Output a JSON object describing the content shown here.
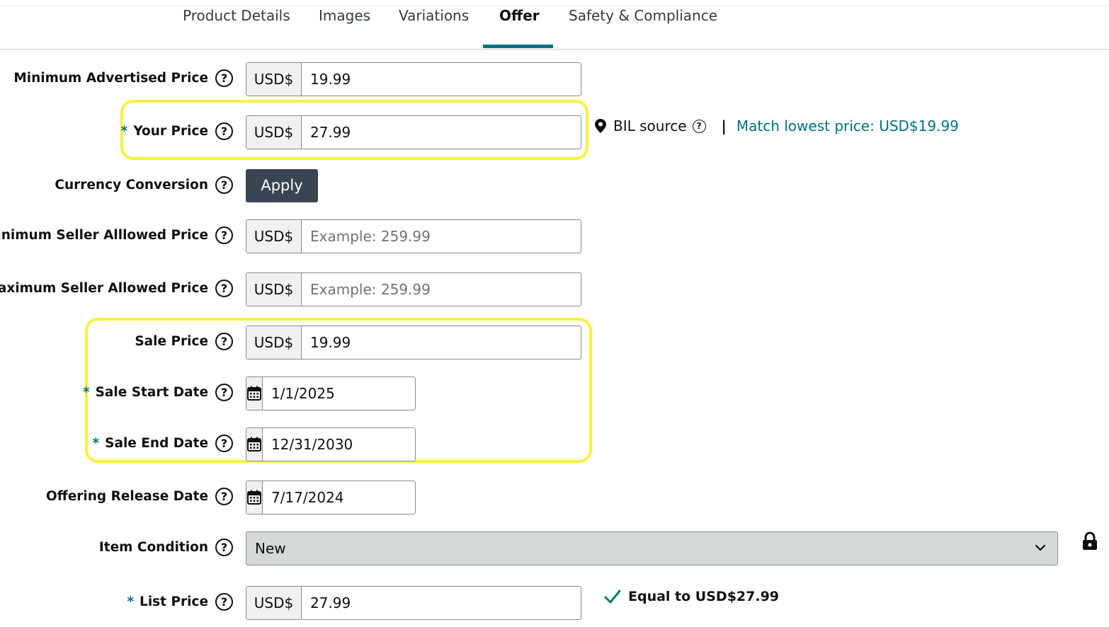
{
  "tabs": [
    {
      "label": "Product Details",
      "active": false
    },
    {
      "label": "Images",
      "active": false
    },
    {
      "label": "Variations",
      "active": false
    },
    {
      "label": "Offer",
      "active": true
    },
    {
      "label": "Safety & Compliance",
      "active": false
    }
  ],
  "currency_prefix": "USD$",
  "help_glyph": "?",
  "required_mark": "*",
  "fields": {
    "map": {
      "label": "Minimum Advertised Price",
      "value": "19.99"
    },
    "your_price": {
      "label": "Your Price",
      "value": "27.99"
    },
    "currency_conversion": {
      "label": "Currency Conversion",
      "button": "Apply"
    },
    "min_seller": {
      "label": "Minimum Seller Alllowed Price",
      "placeholder": "Example: 259.99"
    },
    "max_seller": {
      "label": "Maximum Seller Allowed Price",
      "placeholder": "Example: 259.99"
    },
    "sale_price": {
      "label": "Sale Price",
      "value": "19.99"
    },
    "sale_start": {
      "label": "Sale Start Date",
      "value": "1/1/2025"
    },
    "sale_end": {
      "label": "Sale End Date",
      "value": "12/31/2030"
    },
    "release_date": {
      "label": "Offering Release Date",
      "value": "7/17/2024"
    },
    "condition": {
      "label": "Item Condition",
      "value": "New"
    },
    "list_price": {
      "label": "List Price",
      "value": "27.99"
    }
  },
  "your_price_aside": {
    "bil_source": "BIL source",
    "separator": "|",
    "match_link": "Match lowest price: USD$19.99"
  },
  "list_price_note": "Equal to USD$27.99",
  "colors": {
    "accent": "#007185",
    "highlight": "#f6f33c",
    "button": "#3a4553",
    "check": "#067d62"
  }
}
